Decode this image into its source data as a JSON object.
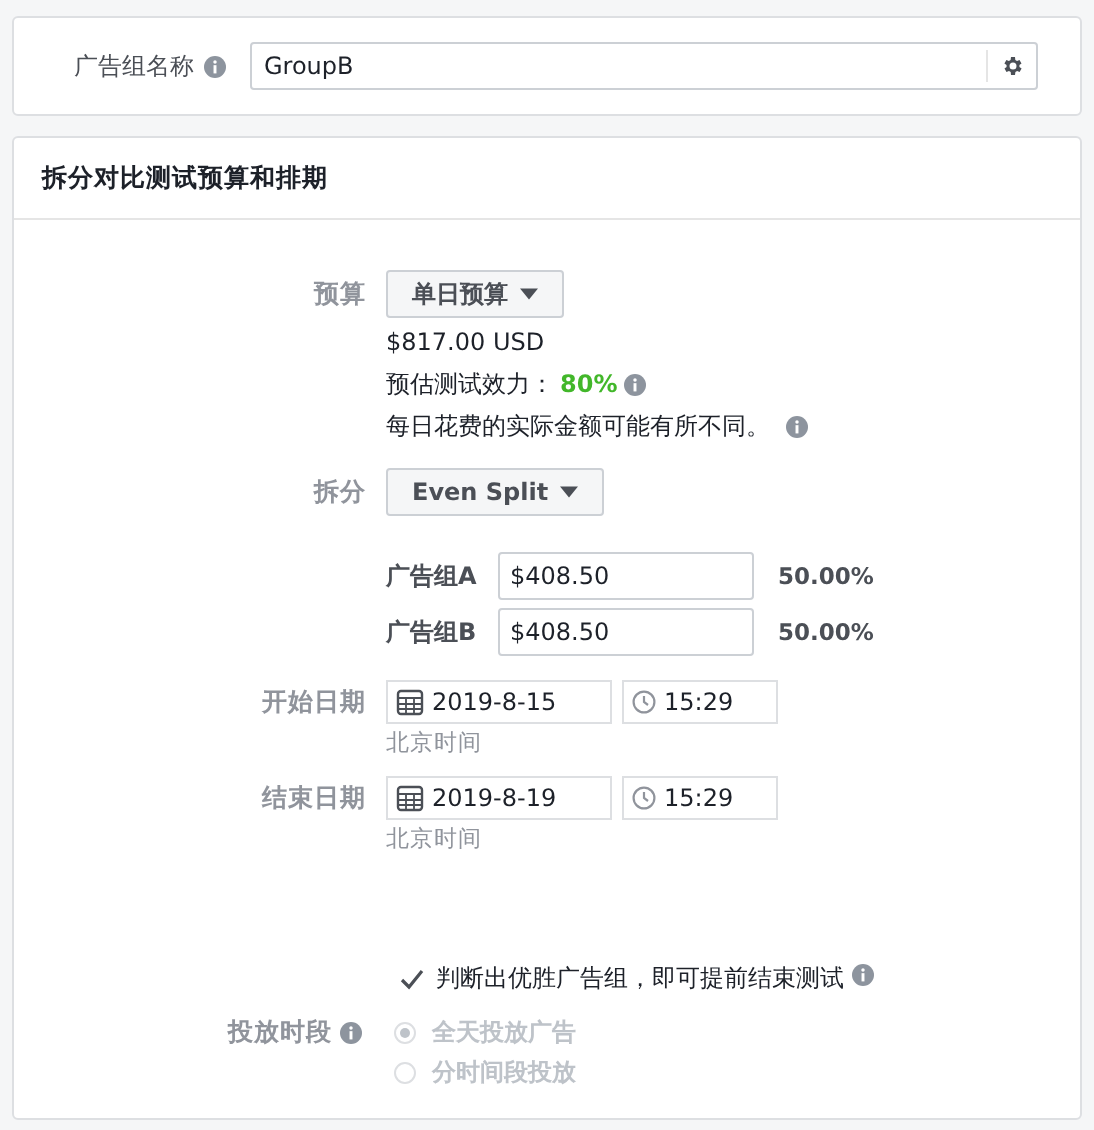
{
  "ad_group_name": {
    "label": "广告组名称",
    "value": "GroupB"
  },
  "section": {
    "title": "拆分对比测试预算和排期"
  },
  "budget": {
    "label": "预算",
    "dropdown": "单日预算",
    "amount": "$817.00 USD",
    "power_label": "预估测试效力：",
    "power_value": "80%",
    "note": "每日花费的实际金额可能有所不同。"
  },
  "split": {
    "label": "拆分",
    "dropdown": "Even Split",
    "groups": [
      {
        "label": "广告组A",
        "value": "$408.50",
        "percent": "50.00%"
      },
      {
        "label": "广告组B",
        "value": "$408.50",
        "percent": "50.00%"
      }
    ]
  },
  "dates": [
    {
      "label": "开始日期",
      "date": "2019-8-15",
      "time": "15:29",
      "timezone": "北京时间"
    },
    {
      "label": "结束日期",
      "date": "2019-8-19",
      "time": "15:29",
      "timezone": "北京时间"
    }
  ],
  "early_end": {
    "label": "判断出优胜广告组，即可提前结束测试",
    "checked": true
  },
  "delivery": {
    "label": "投放时段",
    "disabled": true,
    "options": [
      {
        "label": "全天投放广告",
        "selected": true
      },
      {
        "label": "分时间段投放",
        "selected": false
      }
    ]
  }
}
